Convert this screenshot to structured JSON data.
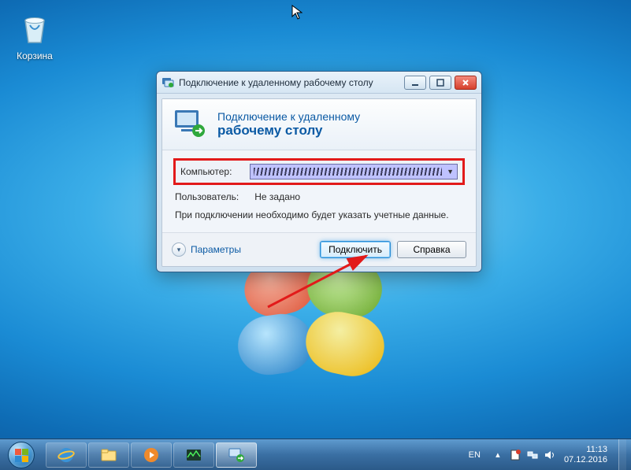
{
  "desktop": {
    "recycle_bin_label": "Корзина"
  },
  "dialog": {
    "title": "Подключение к удаленному рабочему столу",
    "banner_line1": "Подключение к удаленному",
    "banner_line2": "рабочему столу",
    "computer_label": "Компьютер:",
    "computer_value": "",
    "user_label": "Пользователь:",
    "user_value": "Не задано",
    "hint": "При подключении необходимо будет указать учетные данные.",
    "options_label": "Параметры",
    "connect_label": "Подключить",
    "help_label": "Справка"
  },
  "taskbar": {
    "lang": "EN",
    "time": "11:13",
    "date": "07.12.2016"
  }
}
